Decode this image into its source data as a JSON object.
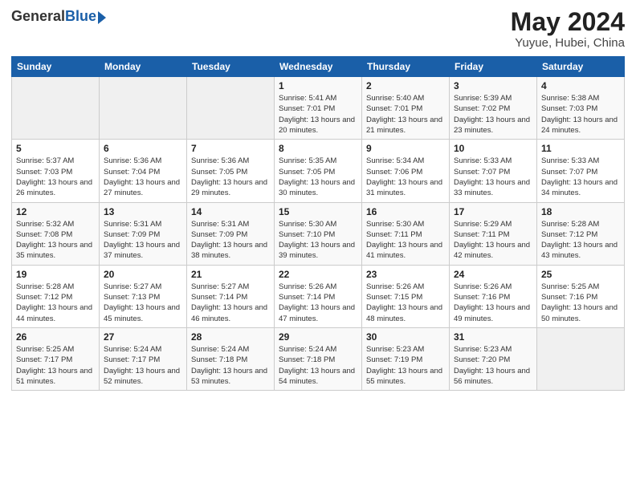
{
  "logo": {
    "general": "General",
    "blue": "Blue"
  },
  "title": "May 2024",
  "subtitle": "Yuyue, Hubei, China",
  "weekdays": [
    "Sunday",
    "Monday",
    "Tuesday",
    "Wednesday",
    "Thursday",
    "Friday",
    "Saturday"
  ],
  "weeks": [
    [
      {
        "day": "",
        "sunrise": "",
        "sunset": "",
        "daylight": ""
      },
      {
        "day": "",
        "sunrise": "",
        "sunset": "",
        "daylight": ""
      },
      {
        "day": "",
        "sunrise": "",
        "sunset": "",
        "daylight": ""
      },
      {
        "day": "1",
        "sunrise": "Sunrise: 5:41 AM",
        "sunset": "Sunset: 7:01 PM",
        "daylight": "Daylight: 13 hours and 20 minutes."
      },
      {
        "day": "2",
        "sunrise": "Sunrise: 5:40 AM",
        "sunset": "Sunset: 7:01 PM",
        "daylight": "Daylight: 13 hours and 21 minutes."
      },
      {
        "day": "3",
        "sunrise": "Sunrise: 5:39 AM",
        "sunset": "Sunset: 7:02 PM",
        "daylight": "Daylight: 13 hours and 23 minutes."
      },
      {
        "day": "4",
        "sunrise": "Sunrise: 5:38 AM",
        "sunset": "Sunset: 7:03 PM",
        "daylight": "Daylight: 13 hours and 24 minutes."
      }
    ],
    [
      {
        "day": "5",
        "sunrise": "Sunrise: 5:37 AM",
        "sunset": "Sunset: 7:03 PM",
        "daylight": "Daylight: 13 hours and 26 minutes."
      },
      {
        "day": "6",
        "sunrise": "Sunrise: 5:36 AM",
        "sunset": "Sunset: 7:04 PM",
        "daylight": "Daylight: 13 hours and 27 minutes."
      },
      {
        "day": "7",
        "sunrise": "Sunrise: 5:36 AM",
        "sunset": "Sunset: 7:05 PM",
        "daylight": "Daylight: 13 hours and 29 minutes."
      },
      {
        "day": "8",
        "sunrise": "Sunrise: 5:35 AM",
        "sunset": "Sunset: 7:05 PM",
        "daylight": "Daylight: 13 hours and 30 minutes."
      },
      {
        "day": "9",
        "sunrise": "Sunrise: 5:34 AM",
        "sunset": "Sunset: 7:06 PM",
        "daylight": "Daylight: 13 hours and 31 minutes."
      },
      {
        "day": "10",
        "sunrise": "Sunrise: 5:33 AM",
        "sunset": "Sunset: 7:07 PM",
        "daylight": "Daylight: 13 hours and 33 minutes."
      },
      {
        "day": "11",
        "sunrise": "Sunrise: 5:33 AM",
        "sunset": "Sunset: 7:07 PM",
        "daylight": "Daylight: 13 hours and 34 minutes."
      }
    ],
    [
      {
        "day": "12",
        "sunrise": "Sunrise: 5:32 AM",
        "sunset": "Sunset: 7:08 PM",
        "daylight": "Daylight: 13 hours and 35 minutes."
      },
      {
        "day": "13",
        "sunrise": "Sunrise: 5:31 AM",
        "sunset": "Sunset: 7:09 PM",
        "daylight": "Daylight: 13 hours and 37 minutes."
      },
      {
        "day": "14",
        "sunrise": "Sunrise: 5:31 AM",
        "sunset": "Sunset: 7:09 PM",
        "daylight": "Daylight: 13 hours and 38 minutes."
      },
      {
        "day": "15",
        "sunrise": "Sunrise: 5:30 AM",
        "sunset": "Sunset: 7:10 PM",
        "daylight": "Daylight: 13 hours and 39 minutes."
      },
      {
        "day": "16",
        "sunrise": "Sunrise: 5:30 AM",
        "sunset": "Sunset: 7:11 PM",
        "daylight": "Daylight: 13 hours and 41 minutes."
      },
      {
        "day": "17",
        "sunrise": "Sunrise: 5:29 AM",
        "sunset": "Sunset: 7:11 PM",
        "daylight": "Daylight: 13 hours and 42 minutes."
      },
      {
        "day": "18",
        "sunrise": "Sunrise: 5:28 AM",
        "sunset": "Sunset: 7:12 PM",
        "daylight": "Daylight: 13 hours and 43 minutes."
      }
    ],
    [
      {
        "day": "19",
        "sunrise": "Sunrise: 5:28 AM",
        "sunset": "Sunset: 7:12 PM",
        "daylight": "Daylight: 13 hours and 44 minutes."
      },
      {
        "day": "20",
        "sunrise": "Sunrise: 5:27 AM",
        "sunset": "Sunset: 7:13 PM",
        "daylight": "Daylight: 13 hours and 45 minutes."
      },
      {
        "day": "21",
        "sunrise": "Sunrise: 5:27 AM",
        "sunset": "Sunset: 7:14 PM",
        "daylight": "Daylight: 13 hours and 46 minutes."
      },
      {
        "day": "22",
        "sunrise": "Sunrise: 5:26 AM",
        "sunset": "Sunset: 7:14 PM",
        "daylight": "Daylight: 13 hours and 47 minutes."
      },
      {
        "day": "23",
        "sunrise": "Sunrise: 5:26 AM",
        "sunset": "Sunset: 7:15 PM",
        "daylight": "Daylight: 13 hours and 48 minutes."
      },
      {
        "day": "24",
        "sunrise": "Sunrise: 5:26 AM",
        "sunset": "Sunset: 7:16 PM",
        "daylight": "Daylight: 13 hours and 49 minutes."
      },
      {
        "day": "25",
        "sunrise": "Sunrise: 5:25 AM",
        "sunset": "Sunset: 7:16 PM",
        "daylight": "Daylight: 13 hours and 50 minutes."
      }
    ],
    [
      {
        "day": "26",
        "sunrise": "Sunrise: 5:25 AM",
        "sunset": "Sunset: 7:17 PM",
        "daylight": "Daylight: 13 hours and 51 minutes."
      },
      {
        "day": "27",
        "sunrise": "Sunrise: 5:24 AM",
        "sunset": "Sunset: 7:17 PM",
        "daylight": "Daylight: 13 hours and 52 minutes."
      },
      {
        "day": "28",
        "sunrise": "Sunrise: 5:24 AM",
        "sunset": "Sunset: 7:18 PM",
        "daylight": "Daylight: 13 hours and 53 minutes."
      },
      {
        "day": "29",
        "sunrise": "Sunrise: 5:24 AM",
        "sunset": "Sunset: 7:18 PM",
        "daylight": "Daylight: 13 hours and 54 minutes."
      },
      {
        "day": "30",
        "sunrise": "Sunrise: 5:23 AM",
        "sunset": "Sunset: 7:19 PM",
        "daylight": "Daylight: 13 hours and 55 minutes."
      },
      {
        "day": "31",
        "sunrise": "Sunrise: 5:23 AM",
        "sunset": "Sunset: 7:20 PM",
        "daylight": "Daylight: 13 hours and 56 minutes."
      },
      {
        "day": "",
        "sunrise": "",
        "sunset": "",
        "daylight": ""
      }
    ]
  ]
}
